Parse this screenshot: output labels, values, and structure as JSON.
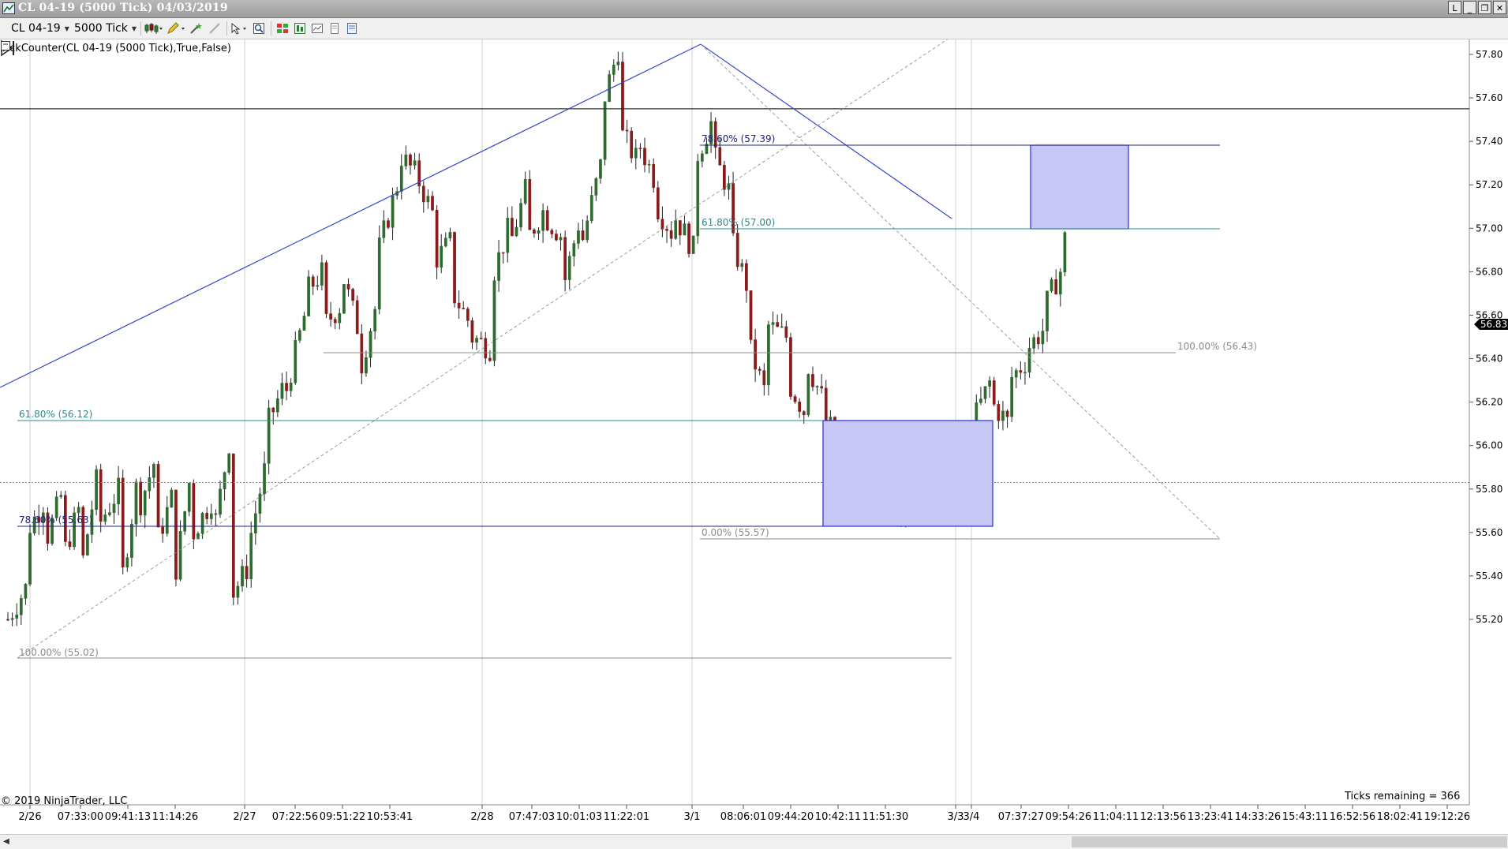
{
  "window": {
    "title": "CL 04-19 (5000 Tick)  04/03/2019",
    "buttons": [
      "L",
      "_",
      "❐",
      "✕"
    ]
  },
  "toolbar": {
    "instrument": "CL 04-19",
    "interval": "5000 Tick",
    "icons": [
      "bar-style-icon",
      "pencil-draw-icon",
      "magic-wand-icon",
      "hide-drawings-icon",
      "cursor-arrow-icon",
      "zoom-icon",
      "strategies-icon",
      "indicators-icon",
      "chart-properties-icon",
      "data-box-icon",
      "templates-icon"
    ]
  },
  "chart": {
    "indicator_label": "TickCounter(CL 04-19 (5000 Tick),True,False)",
    "copyright": "© 2019 NinjaTrader, LLC",
    "ticks_remaining": "Ticks remaining = 366",
    "last_price_label": "56.83"
  },
  "chart_data": {
    "type": "candlestick",
    "instrument": "CL 04-19",
    "interval": "5000 Tick",
    "y_ticks": [
      "57.80",
      "57.60",
      "57.40",
      "57.20",
      "57.00",
      "56.80",
      "56.60",
      "56.40",
      "56.20",
      "56.00",
      "55.80",
      "55.60",
      "55.40",
      "55.20"
    ],
    "ylim": [
      55.04,
      57.89
    ],
    "x_ticks": [
      "2/26",
      "07:33:00",
      "09:41:13",
      "11:14:26",
      "2/27",
      "07:22:56",
      "09:51:22",
      "10:53:41",
      "2/28",
      "07:47:03",
      "10:01:03",
      "11:22:01",
      "3/1",
      "08:06:01",
      "09:44:20",
      "10:42:11",
      "11:51:30",
      "3/3",
      "3/4",
      "07:37:27",
      "09:54:26",
      "11:04:11",
      "12:13:56",
      "13:23:41",
      "14:33:26",
      "15:43:11",
      "16:52:56",
      "18:02:41",
      "19:12:26"
    ],
    "current_price": 56.83,
    "reference_price": 55.83,
    "horizontal_line_price": 57.55,
    "close_path": [
      [
        55.2,
        55.35
      ],
      [
        55.6,
        55.75
      ],
      [
        55.55,
        55.8
      ],
      [
        55.5,
        55.75
      ],
      [
        55.45,
        55.95
      ],
      [
        55.65,
        55.8
      ],
      [
        55.3,
        55.85
      ],
      [
        55.7,
        55.95
      ],
      [
        55.55,
        55.8
      ],
      [
        55.4,
        55.95
      ],
      [
        55.6,
        55.75
      ],
      [
        55.55,
        56.05
      ],
      [
        55.3,
        55.45
      ],
      [
        55.55,
        55.95
      ],
      [
        56.1,
        56.3
      ],
      [
        56.25,
        56.6
      ],
      [
        56.7,
        56.8
      ],
      [
        56.55,
        56.65
      ],
      [
        56.8,
        56.5
      ],
      [
        56.35,
        56.7
      ],
      [
        56.9,
        57.2
      ],
      [
        57.35,
        57.25
      ],
      [
        57.25,
        57.05
      ],
      [
        56.85,
        56.95
      ],
      [
        56.7,
        56.55
      ],
      [
        56.5,
        56.45
      ],
      [
        56.75,
        57.0
      ],
      [
        56.9,
        57.2
      ],
      [
        56.95,
        57.1
      ],
      [
        57.05,
        56.95
      ],
      [
        56.75,
        57.1
      ],
      [
        56.95,
        57.3
      ],
      [
        57.55,
        57.85
      ],
      [
        57.45,
        57.3
      ],
      [
        57.4,
        57.2
      ],
      [
        57.1,
        56.95
      ],
      [
        57.05,
        56.9
      ],
      [
        57.3,
        57.5
      ],
      [
        57.35,
        57.15
      ],
      [
        56.95,
        56.7
      ],
      [
        56.45,
        56.2
      ],
      [
        56.55,
        56.5
      ],
      [
        56.3,
        56.15
      ],
      [
        56.4,
        56.2
      ],
      [
        56.1,
        56.05
      ],
      [
        55.85,
        55.65
      ],
      [
        55.75,
        55.95
      ],
      [
        55.8,
        56.0
      ],
      [
        55.7,
        55.75
      ],
      [
        55.95,
        56.05
      ],
      [
        56.0,
        55.9
      ],
      [
        55.85,
        56.05
      ],
      [
        56.1,
        56.3
      ],
      [
        56.2,
        56.1
      ],
      [
        56.3,
        56.4
      ],
      [
        56.45,
        56.55
      ],
      [
        56.65,
        56.85
      ],
      [
        56.95,
        56.83
      ]
    ]
  },
  "fib_retracements": [
    {
      "label": "100.00% (55.02)",
      "color": "#8c8c8c"
    },
    {
      "label": "61.80% (56.12)",
      "color": "#2e8b8b"
    },
    {
      "label": "78.60% (55.63)",
      "color": "#1a237e"
    },
    {
      "label": "100.00% (56.43)",
      "color": "#8c8c8c"
    },
    {
      "label": "0.00% (55.57)",
      "color": "#8c8c8c"
    },
    {
      "label": "61.80% (57.00)",
      "color": "#2e8b8b"
    },
    {
      "label": "78.60% (57.39)",
      "color": "#1a237e"
    }
  ],
  "drawing_colors": {
    "trend_line": "#3344cc",
    "zone_fill": "#c6c7f5",
    "zone_border": "#2a2ad8",
    "up_candle": "#2e6b2e",
    "down_candle": "#8b1a1a",
    "reference_line": "#e06030"
  }
}
